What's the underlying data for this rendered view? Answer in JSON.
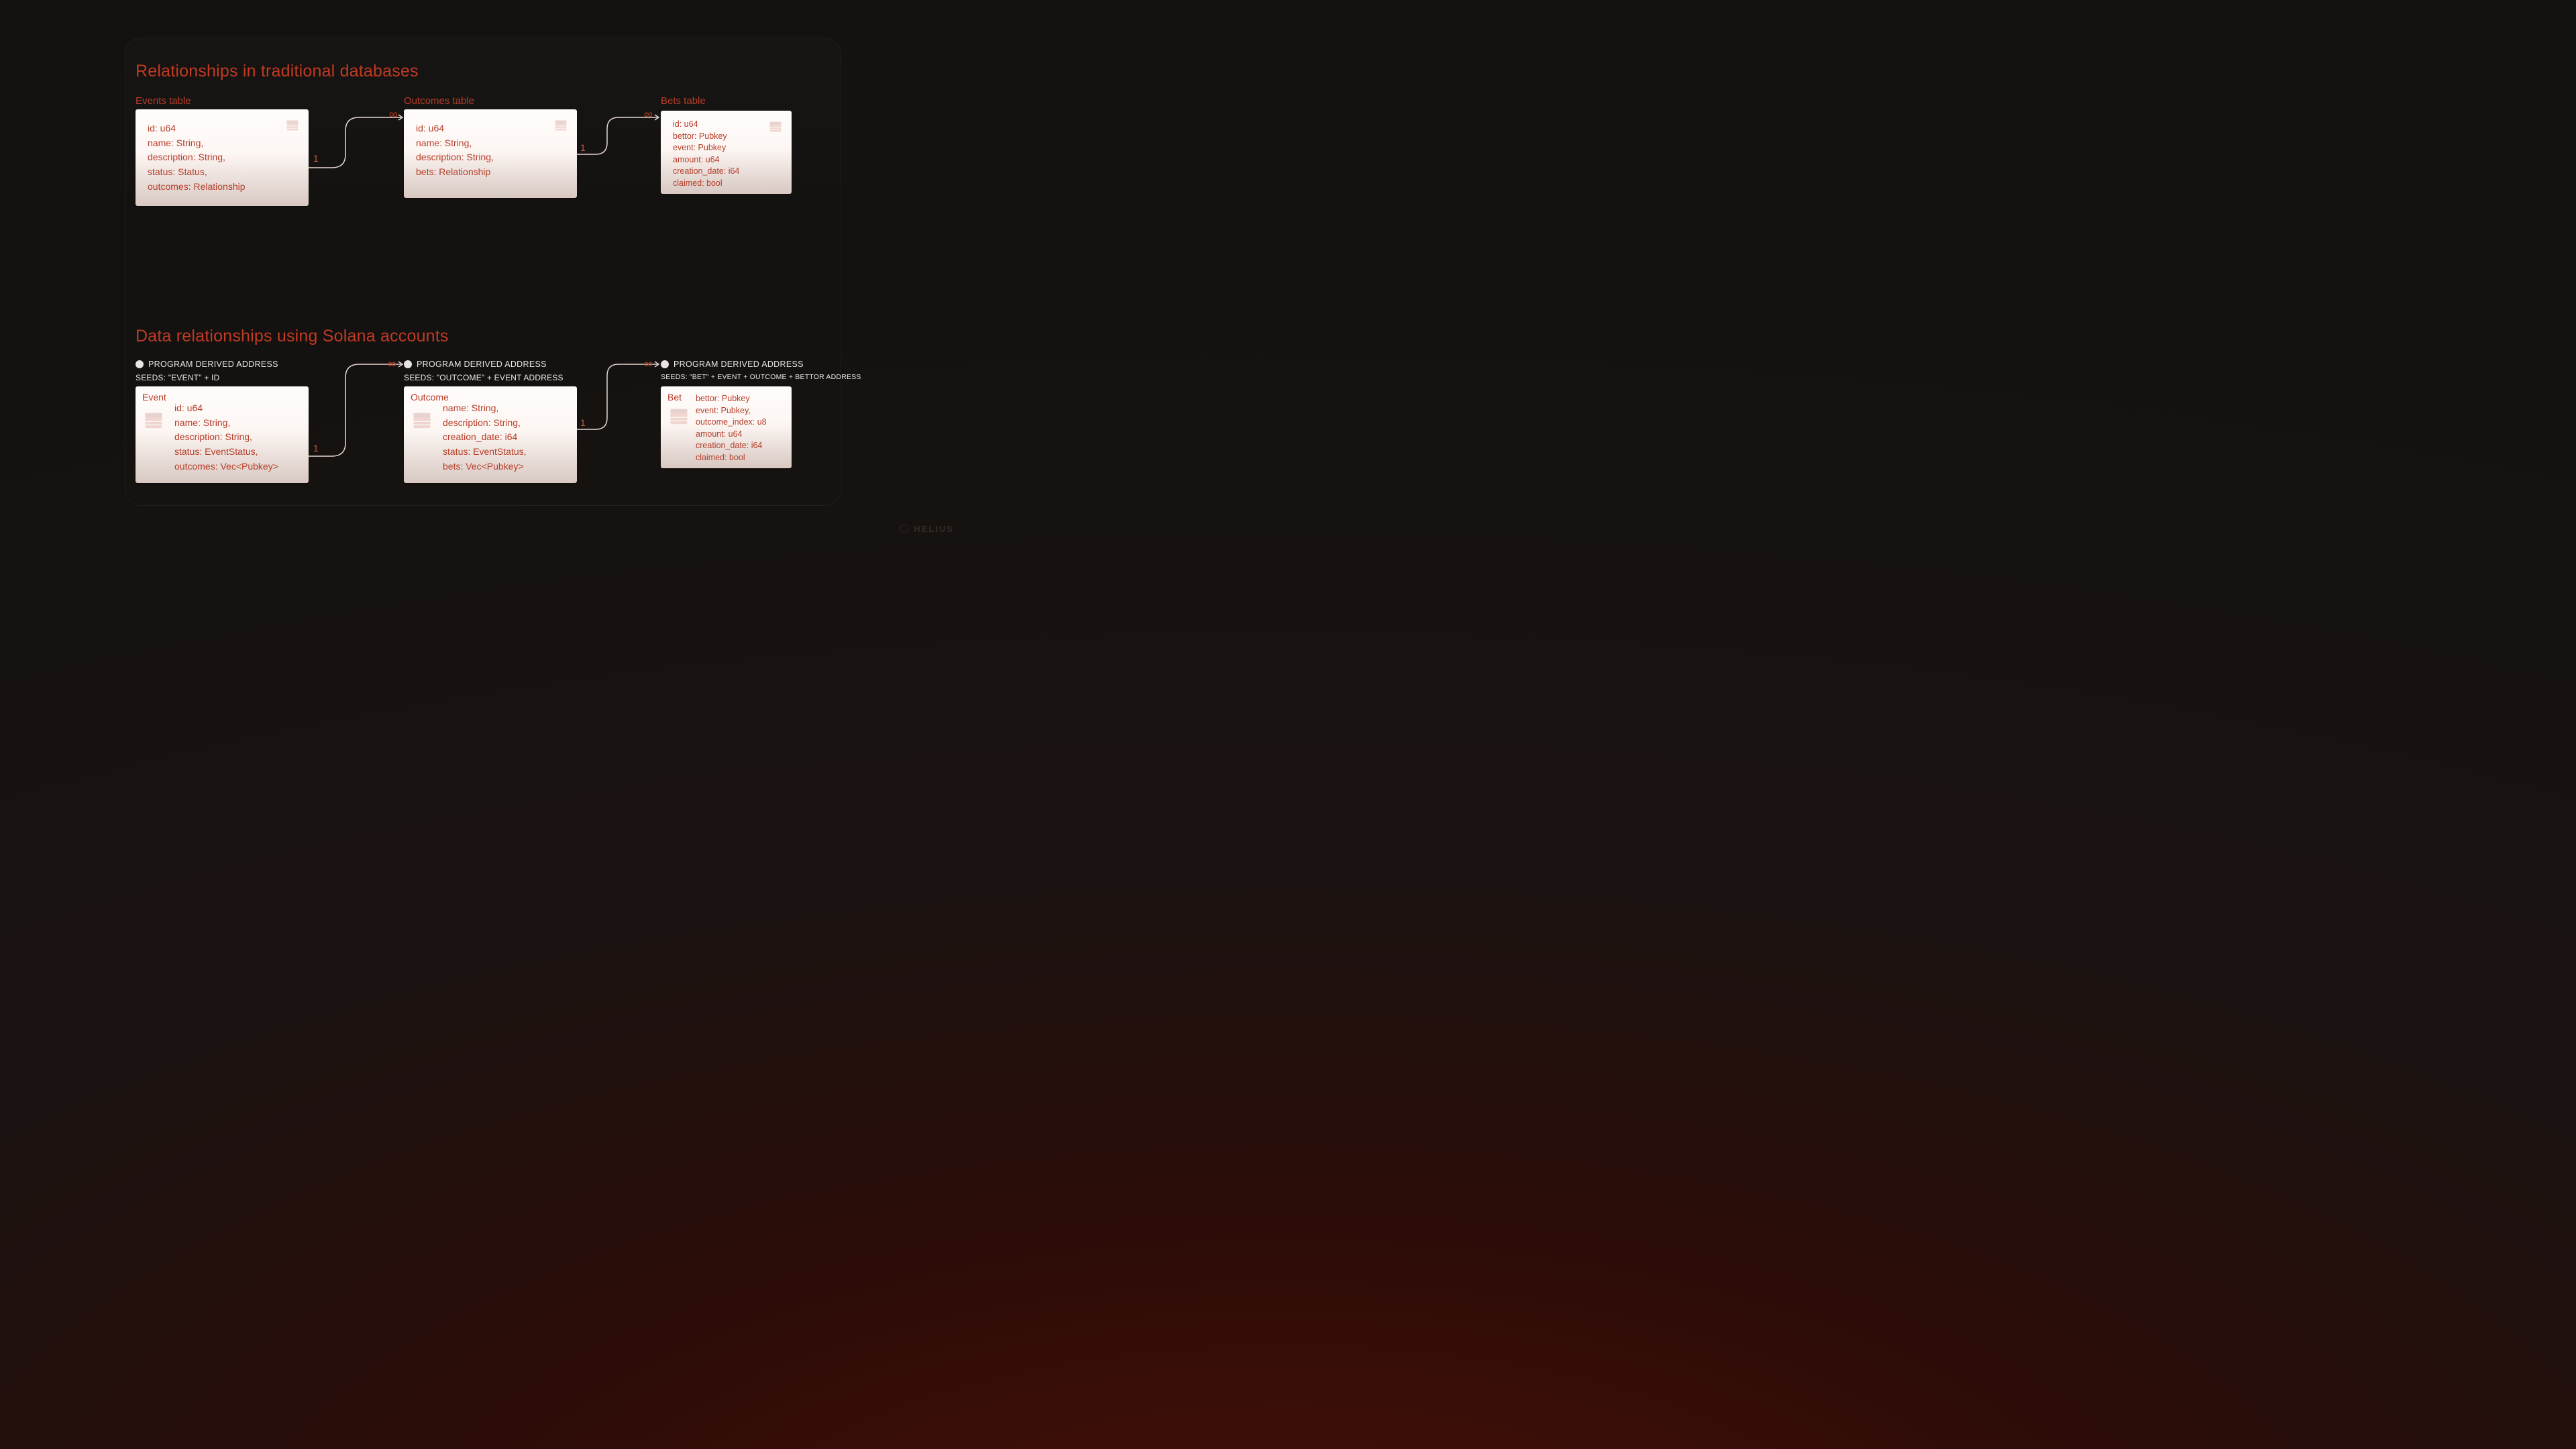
{
  "brand": "HELIUS",
  "section1": {
    "title": "Relationships in traditional databases",
    "labels": {
      "events": "Events table",
      "outcomes": "Outcomes table",
      "bets": "Bets table"
    },
    "cards": {
      "events": {
        "f1": "id: u64",
        "f2": "name: String,",
        "f3": "description: String,",
        "f4": "status: Status,",
        "f5": "outcomes: Relationship"
      },
      "outcomes": {
        "f1": "id: u64",
        "f2": "name: String,",
        "f3": "description: String,",
        "f4": "bets: Relationship"
      },
      "bets": {
        "f1": "id: u64",
        "f2": "bettor: Pubkey",
        "f3": "event: Pubkey",
        "f4": "amount: u64",
        "f5": "creation_date: i64",
        "f6": "claimed: bool"
      }
    },
    "cardinality": {
      "one": "1",
      "inf": "∞"
    }
  },
  "section2": {
    "title": "Data relationships using Solana accounts",
    "pda_label": "PROGRAM DERIVED ADDRESS",
    "seeds": {
      "event": "SEEDS: \"EVENT\" + ID",
      "outcome": "SEEDS: \"OUTCOME\" + EVENT ADDRESS",
      "bet": "SEEDS: \"BET\" + EVENT + OUTCOME + BETTOR ADDRESS"
    },
    "cards": {
      "event": {
        "title": "Event",
        "f1": "id: u64",
        "f2": "name: String,",
        "f3": "description: String,",
        "f4": "status: EventStatus,",
        "f5": "outcomes: Vec<Pubkey>"
      },
      "outcome": {
        "title": "Outcome",
        "f1": "name: String,",
        "f2": "description: String,",
        "f3": "creation_date: i64",
        "f4": "status: EventStatus,",
        "f5": "bets: Vec<Pubkey>"
      },
      "bet": {
        "title": "Bet",
        "f1": "bettor: Pubkey",
        "f2": "event: Pubkey,",
        "f3": "outcome_index: u8",
        "f4": "amount: u64",
        "f5": "creation_date: i64",
        "f6": "claimed: bool"
      }
    },
    "cardinality": {
      "one": "1",
      "inf": "∞"
    }
  }
}
